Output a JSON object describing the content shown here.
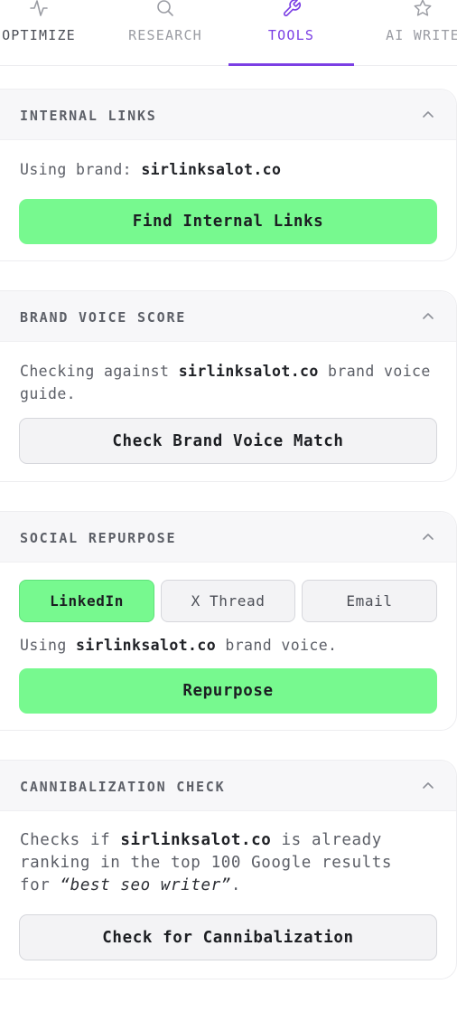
{
  "tabs": [
    {
      "label": "OPTIMIZE",
      "icon": "activity-icon"
    },
    {
      "label": "RESEARCH",
      "icon": "search-icon"
    },
    {
      "label": "TOOLS",
      "icon": "wrench-icon",
      "active": true
    },
    {
      "label": "AI WRITE",
      "icon": "star-icon"
    }
  ],
  "accent_color": "#7b3fe4",
  "primary_button_color": "#77f98f",
  "internal_links": {
    "title": "INTERNAL LINKS",
    "using_prefix": "Using brand: ",
    "brand": "sirlinksalot.co",
    "button": "Find Internal Links"
  },
  "brand_voice": {
    "title": "BRAND VOICE SCORE",
    "line1_prefix": "Checking against ",
    "brand": "sirlinksalot.co",
    "line1_suffix": " brand voice",
    "line2": "guide.",
    "button": "Check Brand Voice Match"
  },
  "social": {
    "title": "SOCIAL REPURPOSE",
    "options": [
      "LinkedIn",
      "X Thread",
      "Email"
    ],
    "selected": "LinkedIn",
    "using_prefix": "Using ",
    "brand": "sirlinksalot.co",
    "using_suffix": " brand voice.",
    "button": "Repurpose"
  },
  "cannibal": {
    "title": "CANNIBALIZATION CHECK",
    "line1_prefix": "Checks if ",
    "brand": "sirlinksalot.co",
    "line1_suffix": " is already",
    "line2": "ranking in the top 100 Google results",
    "line3_prefix": "for ",
    "keyword": "“best seo writer”",
    "line3_suffix": ".",
    "button": "Check for Cannibalization"
  }
}
